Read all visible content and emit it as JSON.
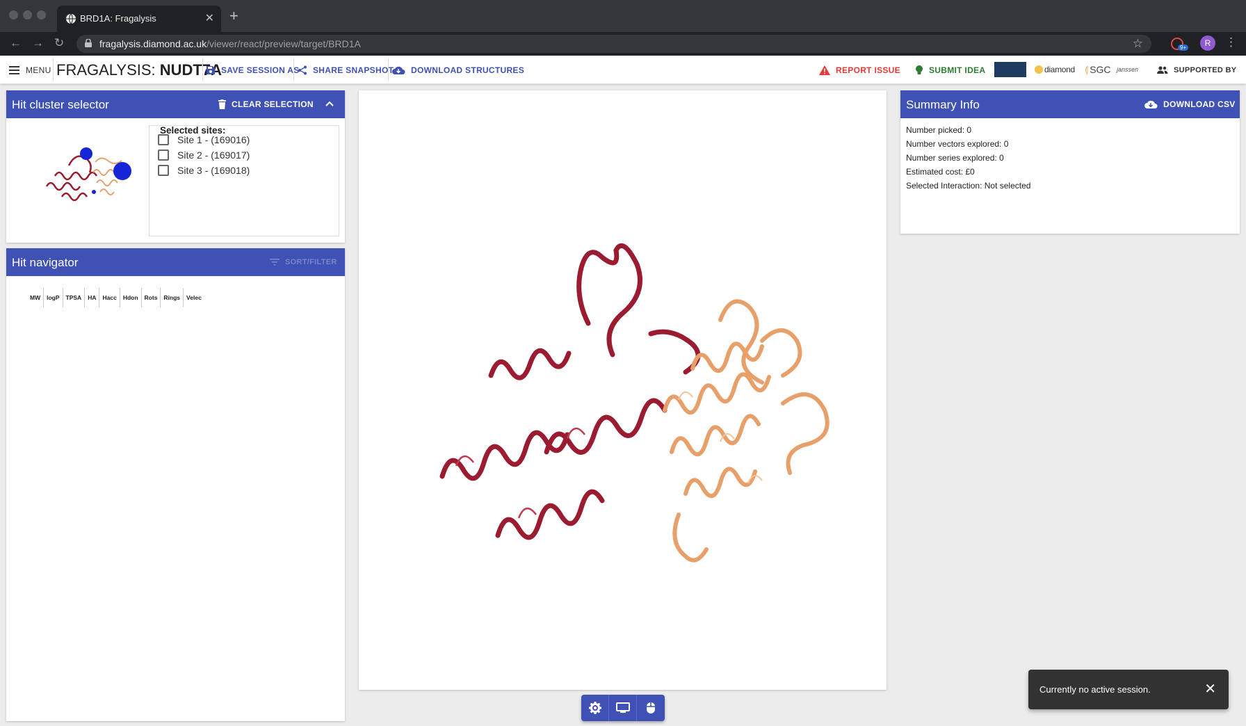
{
  "browser": {
    "tab_title": "BRD1A: Fragalysis",
    "tab_close": "✕",
    "new_tab": "+",
    "url_host": "fragalysis.diamond.ac.uk",
    "url_path": "/viewer/react/preview/target/BRD1A",
    "profile_initial": "R",
    "extension_badge": "9+"
  },
  "toolbar": {
    "menu_label": "MENU",
    "brand_prefix": "FRAGALYSIS: ",
    "brand_target": "NUDT7A",
    "save_session_label": "SAVE SESSION AS",
    "share_snapshot_label": "SHARE SNAPSHOT",
    "download_structures_label": "DOWNLOAD STRUCTURES",
    "report_issue_label": "REPORT ISSUE",
    "submit_idea_label": "SUBMIT IDEA",
    "logo_diamond": "diamond",
    "logo_sgc": "SGC",
    "logo_janssen": "janssen",
    "supported_by_label": "SUPPORTED BY"
  },
  "hit_cluster": {
    "title": "Hit cluster selector",
    "clear_label": "CLEAR SELECTION",
    "selected_sites_label": "Selected sites:",
    "sites": [
      {
        "label": "Site 1 - (169016)"
      },
      {
        "label": "Site 2 - (169017)"
      },
      {
        "label": "Site 3 - (169018)"
      }
    ]
  },
  "hit_navigator": {
    "title": "Hit navigator",
    "sort_filter_label": "SORT/FILTER",
    "columns": [
      "MW",
      "logP",
      "TPSA",
      "HA",
      "Hacc",
      "Hdon",
      "Rots",
      "Rings",
      "Velec"
    ]
  },
  "summary": {
    "title": "Summary Info",
    "download_csv_label": "DOWNLOAD CSV",
    "lines": [
      "Number picked: 0",
      "Number vectors explored: 0",
      "Number series explored: 0",
      "Estimated cost: £0",
      "Selected Interaction: Not selected"
    ]
  },
  "snackbar": {
    "message": "Currently no active session.",
    "close": "✕"
  },
  "colors": {
    "primary": "#3f51b5",
    "chain_a": "#9b1b30",
    "chain_b": "#e8a06a",
    "report_issue": "#e53935",
    "submit_idea": "#2e7d32"
  }
}
